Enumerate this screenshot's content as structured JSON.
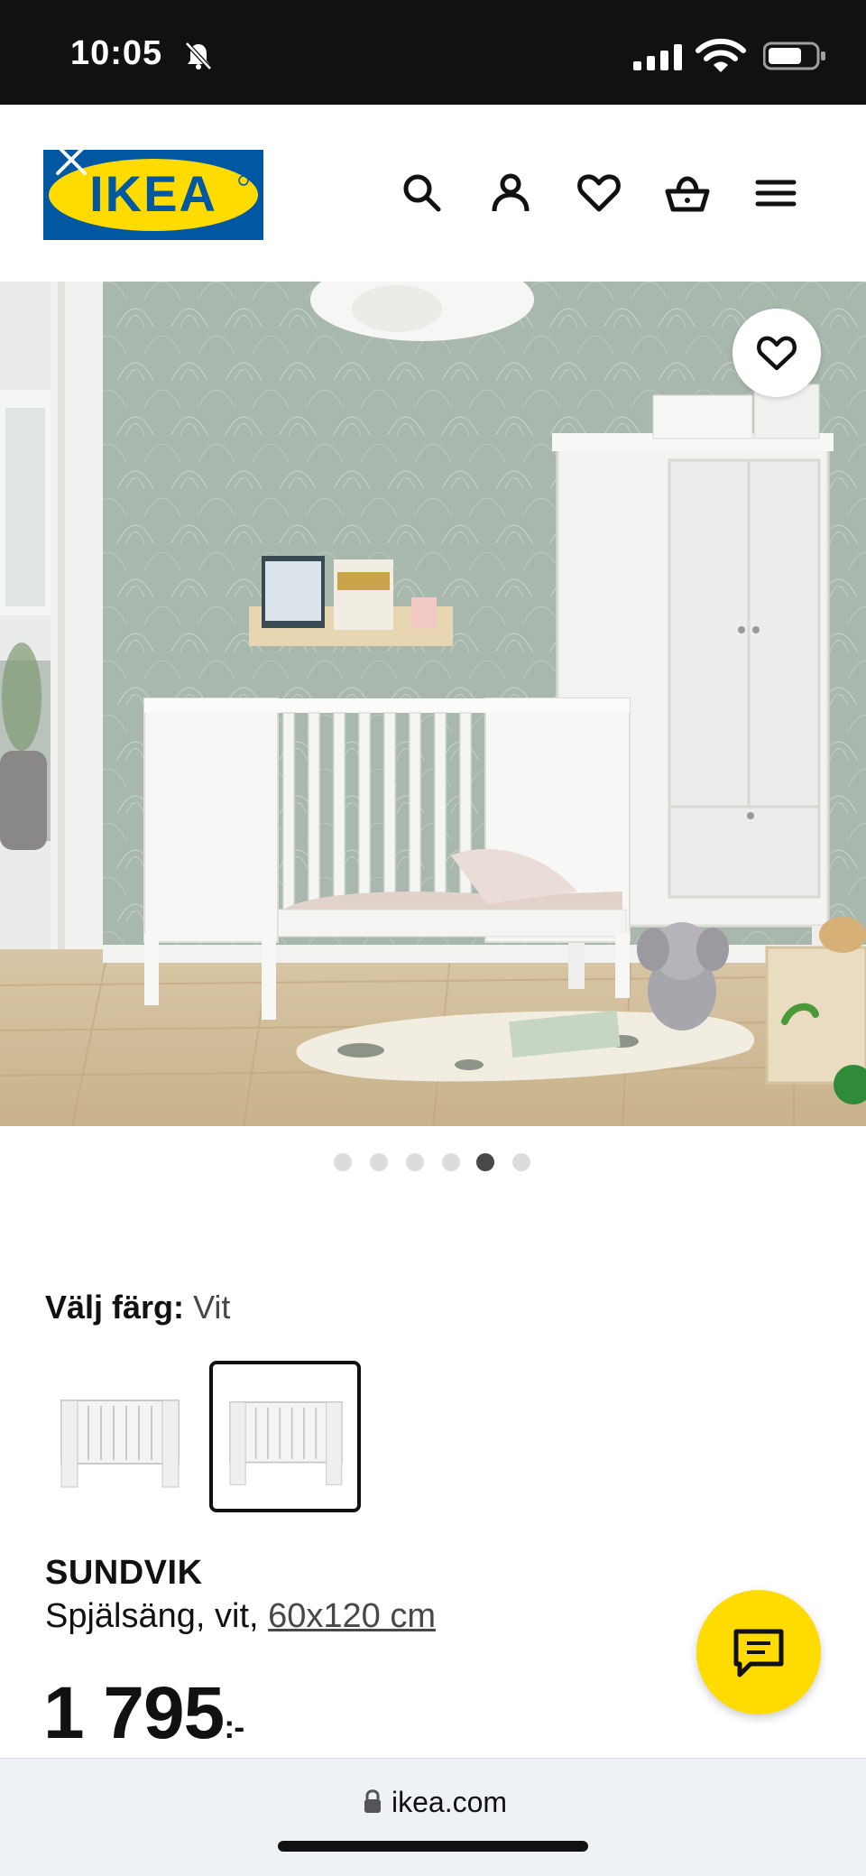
{
  "status_bar": {
    "time": "10:05"
  },
  "header": {
    "logo_text": "IKEA",
    "icons": [
      "search-icon",
      "profile-icon",
      "heart-icon",
      "basket-icon",
      "menu-icon"
    ]
  },
  "gallery": {
    "slide_count": 6,
    "active_slide": 5
  },
  "color_select": {
    "label": "Välj färg:",
    "value": "Vit",
    "swatch_count": 2,
    "selected_swatch": 2
  },
  "product": {
    "name": "SUNDVIK",
    "description_prefix": "Spjälsäng, vit, ",
    "size": "60x120 cm",
    "price": "1 795",
    "price_suffix": ":-"
  },
  "browser": {
    "url": "ikea.com"
  },
  "colors": {
    "ikea_blue": "#0058A3",
    "ikea_yellow": "#FFDB00",
    "text": "#111111"
  }
}
